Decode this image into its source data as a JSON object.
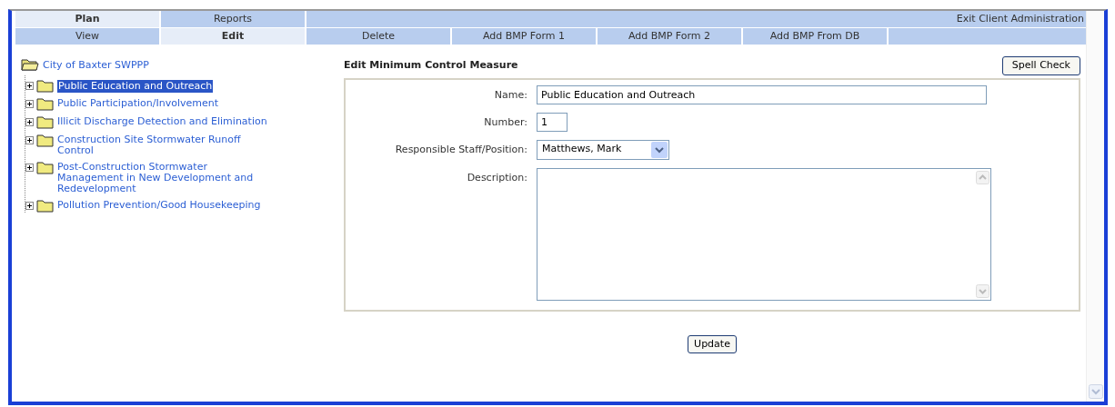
{
  "top_tabs": [
    {
      "label": "Plan",
      "selected": true
    },
    {
      "label": "Reports",
      "selected": false
    }
  ],
  "exit_link": "Exit Client Administration",
  "sub_tabs": [
    {
      "label": "View",
      "selected": false
    },
    {
      "label": "Edit",
      "selected": true
    },
    {
      "label": "Delete",
      "selected": false
    },
    {
      "label": "Add BMP Form 1",
      "selected": false
    },
    {
      "label": "Add BMP Form 2",
      "selected": false
    },
    {
      "label": "Add BMP From DB",
      "selected": false
    }
  ],
  "tree": {
    "label": "City of Baxter SWPPP",
    "expanded": true,
    "children": [
      {
        "label": "Public Education and Outreach",
        "selected": true,
        "expanded": false
      },
      {
        "label": "Public Participation/Involvement",
        "selected": false,
        "expanded": false
      },
      {
        "label": "Illicit Discharge Detection and Elimination",
        "selected": false,
        "expanded": false
      },
      {
        "label": "Construction Site Stormwater Runoff Control",
        "selected": false,
        "expanded": false
      },
      {
        "label": "Post-Construction Stormwater Management in New Development and Redevelopment",
        "selected": false,
        "expanded": false
      },
      {
        "label": "Pollution Prevention/Good Housekeeping",
        "selected": false,
        "expanded": false
      }
    ]
  },
  "form": {
    "title": "Edit Minimum Control Measure",
    "spell_check": "Spell Check",
    "fields": [
      {
        "kind": "text",
        "label": "Name:",
        "value": "Public Education and Outreach"
      },
      {
        "kind": "number",
        "label": "Number:",
        "value": "1"
      },
      {
        "kind": "select",
        "label": "Responsible Staff/Position:",
        "value": "Matthews, Mark"
      },
      {
        "kind": "textarea",
        "label": "Description:"
      }
    ],
    "update": "Update"
  }
}
